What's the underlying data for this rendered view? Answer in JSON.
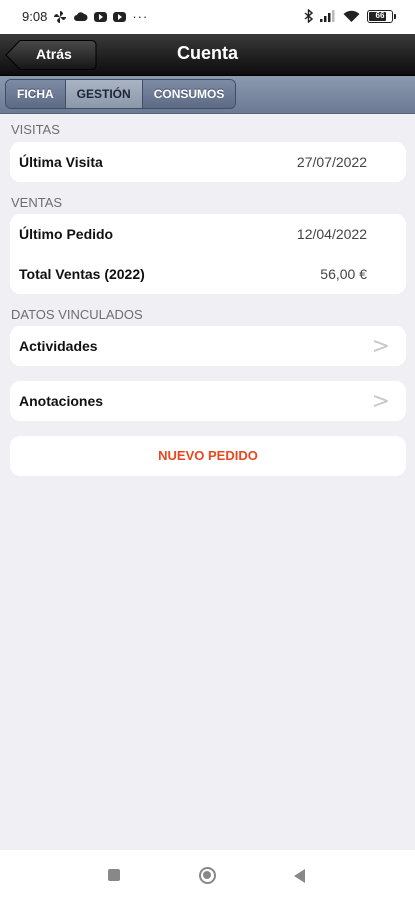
{
  "status_bar": {
    "time": "9:08",
    "dots": "···",
    "battery": "66"
  },
  "nav": {
    "back_label": "Atrás",
    "title": "Cuenta"
  },
  "tabs": [
    {
      "label": "FICHA",
      "active": false
    },
    {
      "label": "GESTIÓN",
      "active": true
    },
    {
      "label": "CONSUMOS",
      "active": false
    }
  ],
  "visitas": {
    "header": "VISITAS",
    "rows": [
      {
        "label": "Última Visita",
        "value": "27/07/2022"
      }
    ]
  },
  "ventas": {
    "header": "VENTAS",
    "rows": [
      {
        "label": "Último Pedido",
        "value": "12/04/2022"
      },
      {
        "label": "Total Ventas (2022)",
        "value": "56,00 €"
      }
    ]
  },
  "vinculados": {
    "header": "DATOS VINCULADOS",
    "items": [
      {
        "label": "Actividades",
        "chevron": ">"
      },
      {
        "label": "Anotaciones",
        "chevron": ">"
      }
    ]
  },
  "action": {
    "label": "NUEVO PEDIDO",
    "color": "#e8471f"
  }
}
